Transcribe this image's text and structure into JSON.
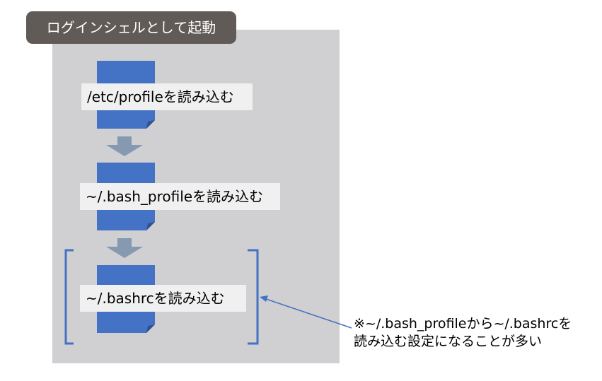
{
  "diagram": {
    "title": "ログインシェルとして起動",
    "steps": [
      {
        "label": "/etc/profileを読み込む"
      },
      {
        "label": "~/.bash_profileを読み込む"
      },
      {
        "label": "~/.bashrcを読み込む"
      }
    ],
    "note": {
      "line1": "※~/.bash_profileから~/.bashrcを",
      "line2": "読み込む設定になることが多い"
    },
    "colors": {
      "panel": "#d0cfd1",
      "title_bg": "#615b58",
      "document": "#4472c4",
      "arrow": "#8599b0",
      "bracket": "#4472c4"
    }
  }
}
